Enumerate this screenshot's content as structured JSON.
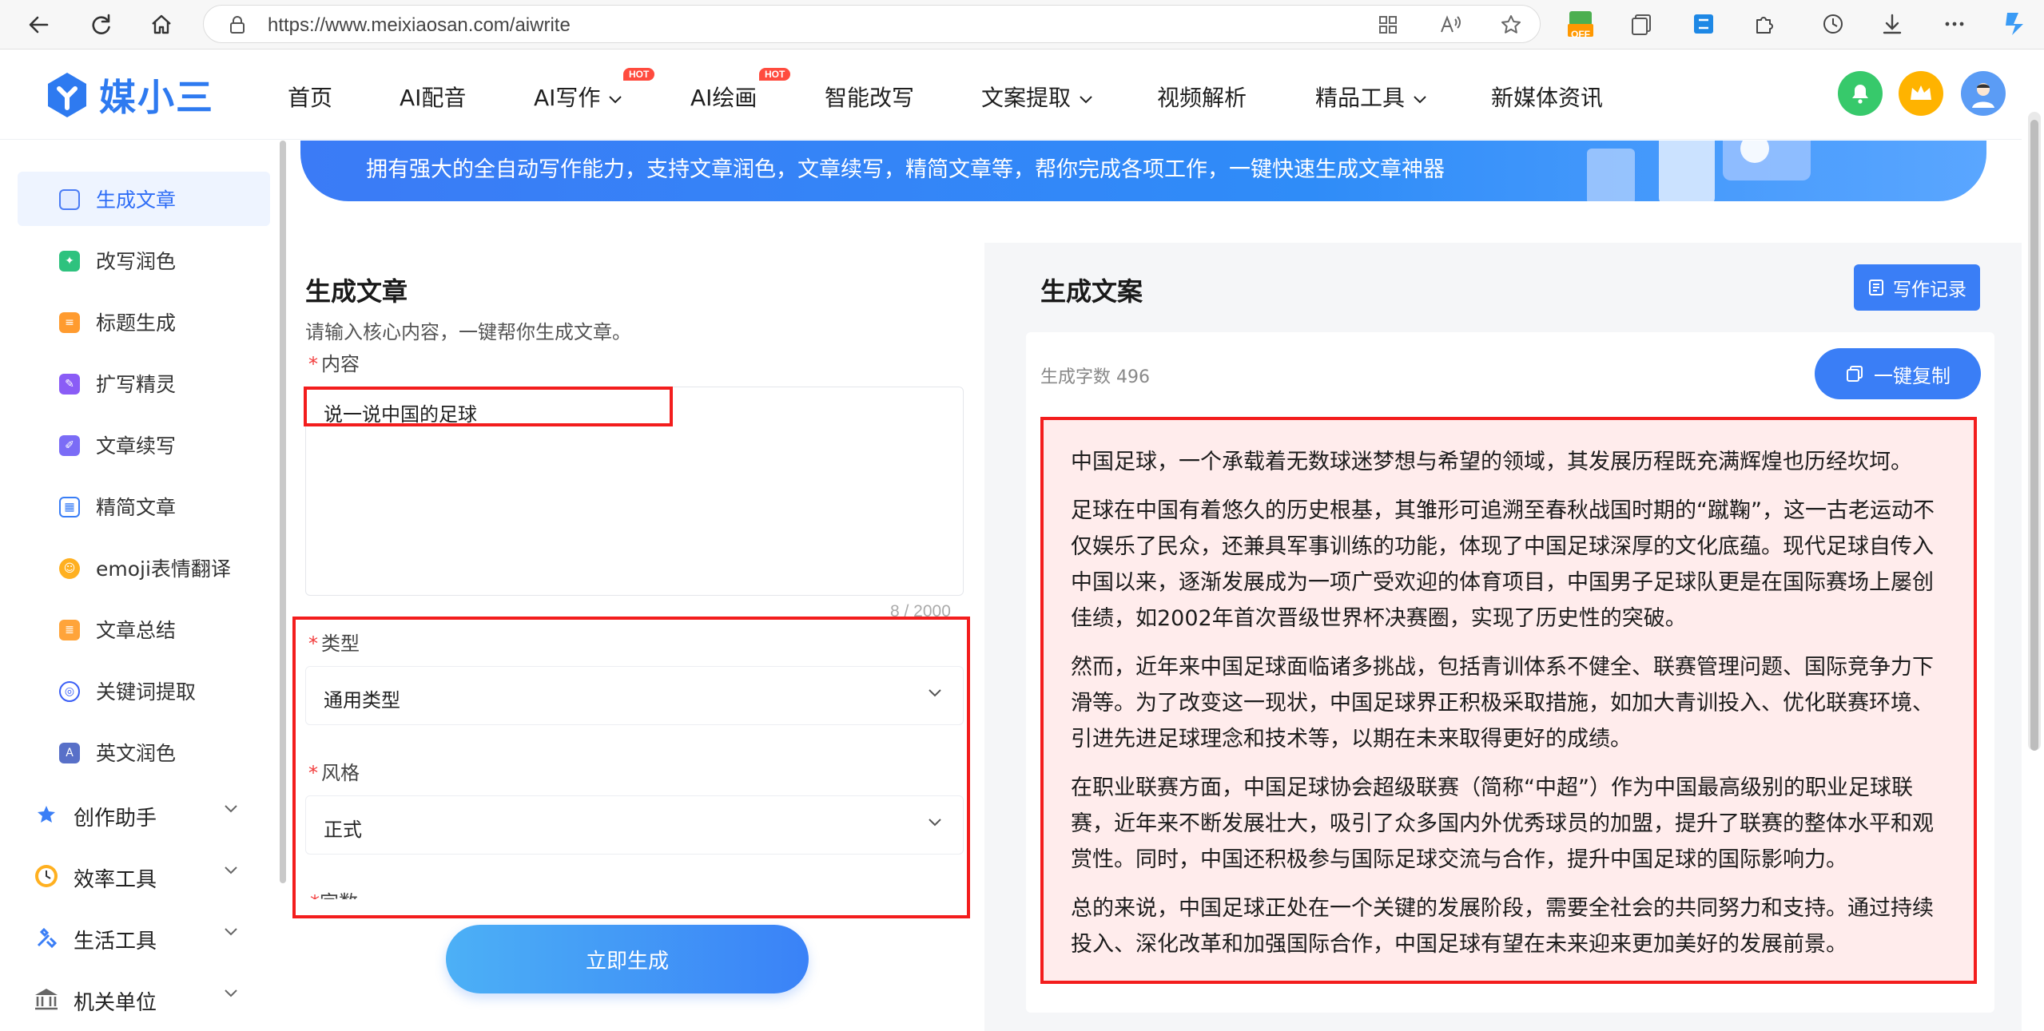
{
  "browser": {
    "url": "https://www.meixiaosan.com/aiwrite",
    "ext_badge": "OFF"
  },
  "site": {
    "logo_text": "媒小三",
    "nav": [
      {
        "label": "首页"
      },
      {
        "label": "AI配音"
      },
      {
        "label": "AI写作"
      },
      {
        "label": "AI绘画"
      },
      {
        "label": "智能改写"
      },
      {
        "label": "文案提取"
      },
      {
        "label": "视频解析"
      },
      {
        "label": "精品工具"
      },
      {
        "label": "新媒体资讯"
      }
    ],
    "hot_badge": "HOT"
  },
  "sidebar": {
    "items": [
      {
        "label": "生成文章",
        "icon": "doc-gen-icon"
      },
      {
        "label": "改写润色",
        "icon": "polish-icon"
      },
      {
        "label": "标题生成",
        "icon": "title-icon"
      },
      {
        "label": "扩写精灵",
        "icon": "expand-icon"
      },
      {
        "label": "文章续写",
        "icon": "continue-icon"
      },
      {
        "label": "精简文章",
        "icon": "simplify-icon"
      },
      {
        "label": "emoji表情翻译",
        "icon": "emoji-icon"
      },
      {
        "label": "文章总结",
        "icon": "summary-icon"
      },
      {
        "label": "关键词提取",
        "icon": "keyword-icon"
      },
      {
        "label": "英文润色",
        "icon": "english-icon"
      }
    ],
    "groups": [
      {
        "label": "创作助手"
      },
      {
        "label": "效率工具"
      },
      {
        "label": "生活工具"
      },
      {
        "label": "机关单位"
      }
    ]
  },
  "banner": {
    "text": "拥有强大的全自动写作能力，支持文章润色，文章续写，精简文章等，帮你完成各项工作，一键快速生成文章神器"
  },
  "form": {
    "title": "生成文章",
    "subtitle": "请输入核心内容，一键帮你生成文章。",
    "required_mark": "*",
    "content_label": "内容",
    "content_value": "说一说中国的足球",
    "char_count": "8 / 2000",
    "type_label": "类型",
    "type_value": "通用类型",
    "style_label": "风格",
    "style_value": "正式",
    "words_label": "字数",
    "generate_button": "立即生成"
  },
  "output": {
    "title": "生成文案",
    "history_button": "写作记录",
    "word_count": "生成字数 496",
    "copy_button": "一键复制",
    "paragraphs": [
      "中国足球，一个承载着无数球迷梦想与希望的领域，其发展历程既充满辉煌也历经坎坷。",
      "足球在中国有着悠久的历史根基，其雏形可追溯至春秋战国时期的“蹴鞠”，这一古老运动不仅娱乐了民众，还兼具军事训练的功能，体现了中国足球深厚的文化底蕴。现代足球自传入中国以来，逐渐发展成为一项广受欢迎的体育项目，中国男子足球队更是在国际赛场上屡创佳绩，如2002年首次晋级世界杯决赛圈，实现了历史性的突破。",
      "然而，近年来中国足球面临诸多挑战，包括青训体系不健全、联赛管理问题、国际竞争力下滑等。为了改变这一现状，中国足球界正积极采取措施，如加大青训投入、优化联赛环境、引进先进足球理念和技术等，以期在未来取得更好的成绩。",
      "在职业联赛方面，中国足球协会超级联赛（简称“中超”）作为中国最高级别的职业足球联赛，近年来不断发展壮大，吸引了众多国内外优秀球员的加盟，提升了联赛的整体水平和观赏性。同时，中国还积极参与国际足球交流与合作，提升中国足球的国际影响力。",
      "总的来说，中国足球正处在一个关键的发展阶段，需要全社会的共同努力和支持。通过持续投入、深化改革和加强国际合作，中国足球有望在未来迎来更加美好的发展前景。"
    ]
  },
  "colors": {
    "accent": "#3a7ef6",
    "highlight_border": "#f31d1d",
    "highlight_fill": "#ffecec"
  }
}
